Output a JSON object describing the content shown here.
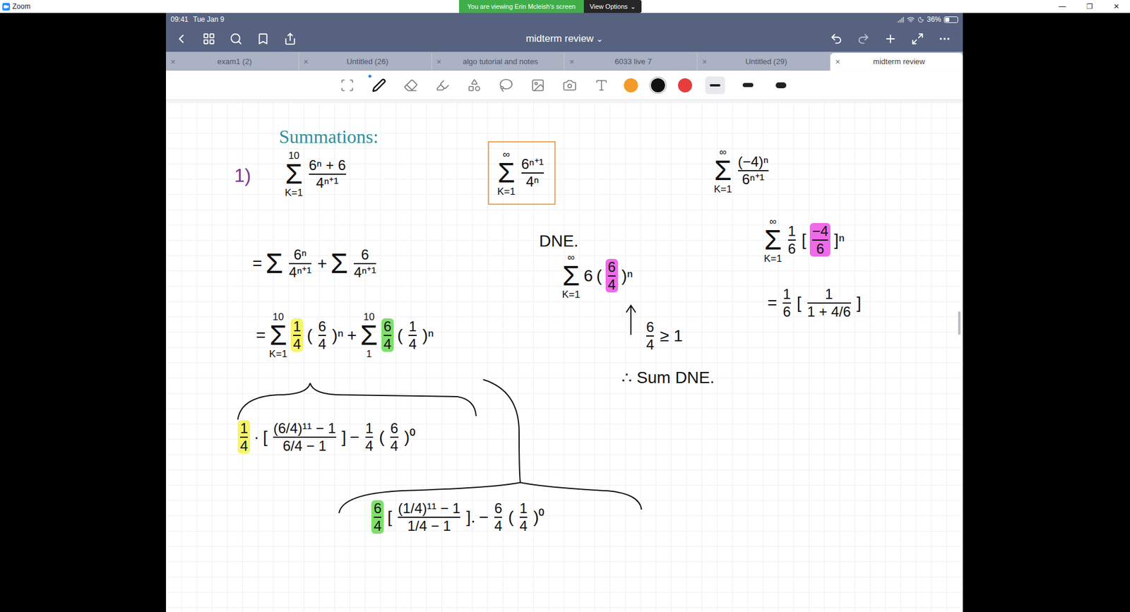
{
  "window": {
    "title": "Zoom",
    "controls": [
      "—",
      "❐",
      "✕"
    ],
    "banner": "You are viewing Erin Mcleish's screen",
    "view_options": "View Options",
    "view_options_chevron": "⌄"
  },
  "status_bar": {
    "time": "09:41",
    "date": "Tue Jan 9",
    "battery": "36%",
    "battery_level": 0.36
  },
  "nav": {
    "title": "midterm review",
    "chevron": "⌄"
  },
  "tabs": [
    {
      "label": "exam1 (2)",
      "close": "×",
      "selected": false
    },
    {
      "label": "Untitled (26)",
      "close": "×",
      "selected": false
    },
    {
      "label": "algo tutorial and notes",
      "close": "×",
      "selected": false
    },
    {
      "label": "6033 live 7",
      "close": "×",
      "selected": false
    },
    {
      "label": "Untitled (29)",
      "close": "×",
      "selected": false
    },
    {
      "label": "midterm review",
      "close": "×",
      "selected": true
    }
  ],
  "toolbar": {
    "tools": [
      {
        "kind": "zoom",
        "selected": false
      },
      {
        "kind": "pen",
        "selected": true
      },
      {
        "kind": "eraser",
        "selected": false
      },
      {
        "kind": "highlighter",
        "selected": false
      },
      {
        "kind": "shapes",
        "selected": false
      },
      {
        "kind": "lasso",
        "selected": false
      },
      {
        "kind": "image",
        "selected": false
      },
      {
        "kind": "camera",
        "selected": false
      },
      {
        "kind": "text",
        "selected": false
      }
    ],
    "colors": [
      {
        "color": "#f39a2b",
        "selected": false
      },
      {
        "color": "#111111",
        "selected": true
      },
      {
        "color": "#e63d3d",
        "selected": false
      }
    ],
    "widths": [
      {
        "level": 0.2,
        "selected": true
      },
      {
        "level": 0.5,
        "selected": false
      },
      {
        "level": 0.8,
        "selected": false
      }
    ]
  },
  "notes": {
    "heading": "Summations:",
    "problem_number": "1)",
    "expressions": [
      {
        "boxed": false,
        "tokens": [
          {
            "kind": "sum",
            "symbol": "Σ",
            "top": "10",
            "bottom": "K=1"
          },
          {
            "kind": "frac",
            "num": "6ⁿ + 6",
            "den": "4ⁿ⁺¹"
          }
        ]
      },
      {
        "boxed": false,
        "tokens": [
          {
            "kind": "text",
            "t": "="
          },
          {
            "kind": "sum",
            "symbol": "Σ"
          },
          {
            "kind": "frac",
            "num": "6ⁿ",
            "den": "4ⁿ⁺¹"
          },
          {
            "kind": "text",
            "t": "+"
          },
          {
            "kind": "sum",
            "symbol": "Σ"
          },
          {
            "kind": "frac",
            "num": "6",
            "den": "4ⁿ⁺¹"
          }
        ]
      },
      {
        "boxed": false,
        "tokens": [
          {
            "kind": "text",
            "t": "="
          },
          {
            "kind": "sum",
            "symbol": "Σ",
            "top": "10",
            "bottom": "K=1"
          },
          {
            "kind": "frac",
            "num": "1",
            "den": "4",
            "highlight": "#f7f56a"
          },
          {
            "kind": "text",
            "t": "("
          },
          {
            "kind": "frac",
            "num": "6",
            "den": "4"
          },
          {
            "kind": "text",
            "t": ")ⁿ"
          },
          {
            "kind": "text",
            "t": "+"
          },
          {
            "kind": "sum",
            "symbol": "Σ",
            "top": "10",
            "bottom": "1"
          },
          {
            "kind": "frac",
            "num": "6",
            "den": "4",
            "highlight": "#7ee06a"
          },
          {
            "kind": "text",
            "t": "("
          },
          {
            "kind": "frac",
            "num": "1",
            "den": "4"
          },
          {
            "kind": "text",
            "t": ")ⁿ"
          }
        ]
      },
      {
        "boxed": false,
        "tokens": [
          {
            "kind": "frac",
            "num": "1",
            "den": "4",
            "highlight": "#f7f56a"
          },
          {
            "kind": "text",
            "t": "·"
          },
          {
            "kind": "text",
            "t": "["
          },
          {
            "kind": "frac",
            "num": "(6/4)¹¹ − 1",
            "den": "6/4 − 1"
          },
          {
            "kind": "text",
            "t": "]"
          },
          {
            "kind": "text",
            "t": "−"
          },
          {
            "kind": "frac",
            "num": "1",
            "den": "4"
          },
          {
            "kind": "text",
            "t": "("
          },
          {
            "kind": "frac",
            "num": "6",
            "den": "4"
          },
          {
            "kind": "text",
            "t": ")⁰"
          }
        ]
      },
      {
        "boxed": false,
        "tokens": [
          {
            "kind": "frac",
            "num": "6",
            "den": "4",
            "highlight": "#7ee06a"
          },
          {
            "kind": "text",
            "t": "["
          },
          {
            "kind": "frac",
            "num": "(1/4)¹¹ − 1",
            "den": "1/4 − 1"
          },
          {
            "kind": "text",
            "t": "]."
          },
          {
            "kind": "text",
            "t": "−"
          },
          {
            "kind": "frac",
            "num": "6",
            "den": "4"
          },
          {
            "kind": "text",
            "t": "("
          },
          {
            "kind": "frac",
            "num": "1",
            "den": "4"
          },
          {
            "kind": "text",
            "t": ")⁰"
          }
        ]
      },
      {
        "boxed": true,
        "tokens": [
          {
            "kind": "sum",
            "symbol": "Σ",
            "top": "∞",
            "bottom": "K=1"
          },
          {
            "kind": "frac",
            "num": "6ⁿ⁺¹",
            "den": "4ⁿ"
          }
        ]
      },
      {
        "boxed": false,
        "tokens": [
          {
            "kind": "text",
            "t": "DNE."
          }
        ]
      },
      {
        "boxed": false,
        "tokens": [
          {
            "kind": "sum",
            "symbol": "Σ",
            "top": "∞",
            "bottom": "K=1"
          },
          {
            "kind": "text",
            "t": "6"
          },
          {
            "kind": "text",
            "t": "("
          },
          {
            "kind": "frac",
            "num": "6",
            "den": "4",
            "highlight": "#ef6ae8"
          },
          {
            "kind": "text",
            "t": ")ⁿ"
          }
        ]
      },
      {
        "boxed": false,
        "tokens": [
          {
            "kind": "frac",
            "num": "6",
            "den": "4"
          },
          {
            "kind": "text",
            "t": "≥ 1"
          }
        ]
      },
      {
        "boxed": false,
        "tokens": [
          {
            "kind": "text",
            "t": "∴ Sum DNE."
          }
        ]
      },
      {
        "boxed": false,
        "tokens": [
          {
            "kind": "sum",
            "symbol": "Σ",
            "top": "∞",
            "bottom": "K=1"
          },
          {
            "kind": "frac",
            "num": "(−4)ⁿ",
            "den": "6ⁿ⁺¹"
          }
        ]
      },
      {
        "boxed": false,
        "tokens": [
          {
            "kind": "sum",
            "symbol": "Σ",
            "top": "∞",
            "bottom": "K=1"
          },
          {
            "kind": "frac",
            "num": "1",
            "den": "6"
          },
          {
            "kind": "text",
            "t": "["
          },
          {
            "kind": "frac",
            "num": "−4",
            "den": "6",
            "highlight": "#ef6ae8"
          },
          {
            "kind": "text",
            "t": "]ⁿ"
          }
        ]
      },
      {
        "boxed": false,
        "tokens": [
          {
            "kind": "text",
            "t": "="
          },
          {
            "kind": "frac",
            "num": "1",
            "den": "6"
          },
          {
            "kind": "text",
            "t": "["
          },
          {
            "kind": "frac",
            "num": "1",
            "den": "1 + 4/6"
          },
          {
            "kind": "text",
            "t": "]"
          }
        ]
      }
    ]
  }
}
